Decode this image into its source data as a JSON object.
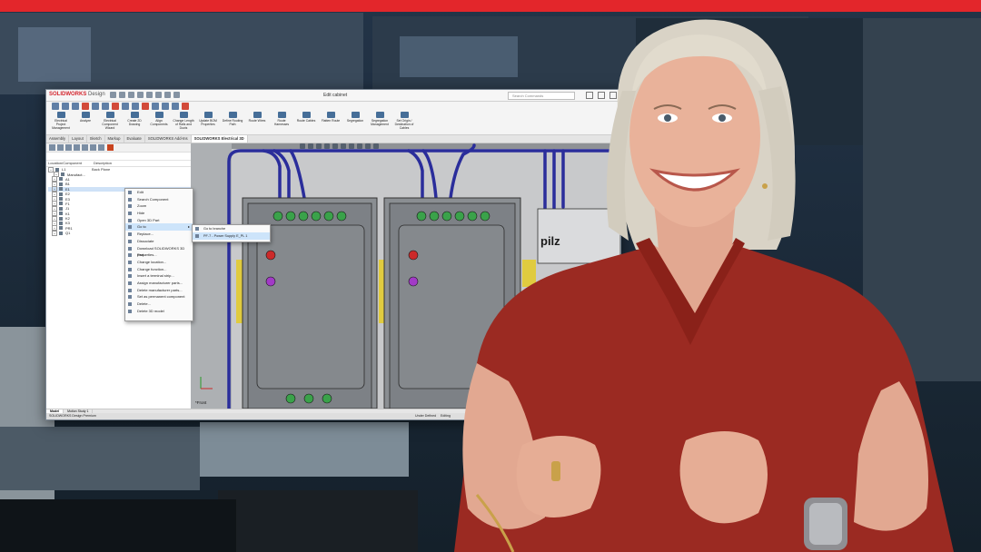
{
  "window": {
    "logo": "SOLIDWORKS",
    "logo_suffix": "Design",
    "doc_title": "Edit cabinet",
    "search_placeholder": "Search Commands"
  },
  "ribbon": {
    "buttons": [
      "Electrical Project Management",
      "Analyze",
      "Electrical Component Wizard",
      "Create 2D Drawing",
      "Align Components",
      "Change Length of Rails and Ducts",
      "Update BOM Properties",
      "Define Routing Path",
      "Route Wires",
      "Route Harnesses",
      "Route Cables",
      "Flatten Route",
      "Segregation",
      "Segregation Management",
      "Set Origin / Destination of Cables"
    ]
  },
  "tabs": [
    "Assembly",
    "Layout",
    "Sketch",
    "Markup",
    "Evaluate",
    "SOLIDWORKS Add-Ins",
    "SOLIDWORKS Electrical 3D"
  ],
  "tree": {
    "col_component": "Location/Component",
    "col_description": "Description",
    "rows": [
      {
        "label": "L1",
        "desc": "Back Plane"
      },
      {
        "label": "Manufact...",
        "desc": ""
      },
      {
        "label": "A1",
        "desc": ""
      },
      {
        "label": "B1",
        "desc": ""
      },
      {
        "label": "E1",
        "desc": ""
      },
      {
        "label": "E2",
        "desc": ""
      },
      {
        "label": "E3",
        "desc": ""
      },
      {
        "label": "F1",
        "desc": ""
      },
      {
        "label": "J1",
        "desc": ""
      },
      {
        "label": "K1",
        "desc": ""
      },
      {
        "label": "K2",
        "desc": ""
      },
      {
        "label": "K3",
        "desc": ""
      },
      {
        "label": "PR1",
        "desc": ""
      },
      {
        "label": "Q1",
        "desc": ""
      }
    ]
  },
  "context_menu": {
    "items": [
      "Edit",
      "Search Component",
      "Zoom",
      "Hide",
      "Open 3D Part",
      "Go to",
      "Replace...",
      "Dissociate",
      "Download SOLIDWORKS 3D part...",
      "Properties...",
      "Change location...",
      "Change function...",
      "Insert a terminal strip...",
      "Assign manufacturer parts...",
      "Delete manufacturer parts...",
      "Set as permanent component",
      "Delete...",
      "Delete 3D model"
    ],
    "highlight_index": 5,
    "submenu": [
      "Go to branche",
      "PF-7 - Power Supply E_PL 1"
    ]
  },
  "viewport": {
    "view_label": "*Front",
    "brand_label": "pilz"
  },
  "bottom_tabs": [
    "Model",
    "Motion Study 1"
  ],
  "status": {
    "left": "SOLIDWORKS Design Premium",
    "defined": "Under Defined",
    "mode": "Editing"
  },
  "colors": {
    "brand_bar": "#e3262b",
    "shirt": "#9b2a22",
    "wire": "#2a2d9b"
  }
}
